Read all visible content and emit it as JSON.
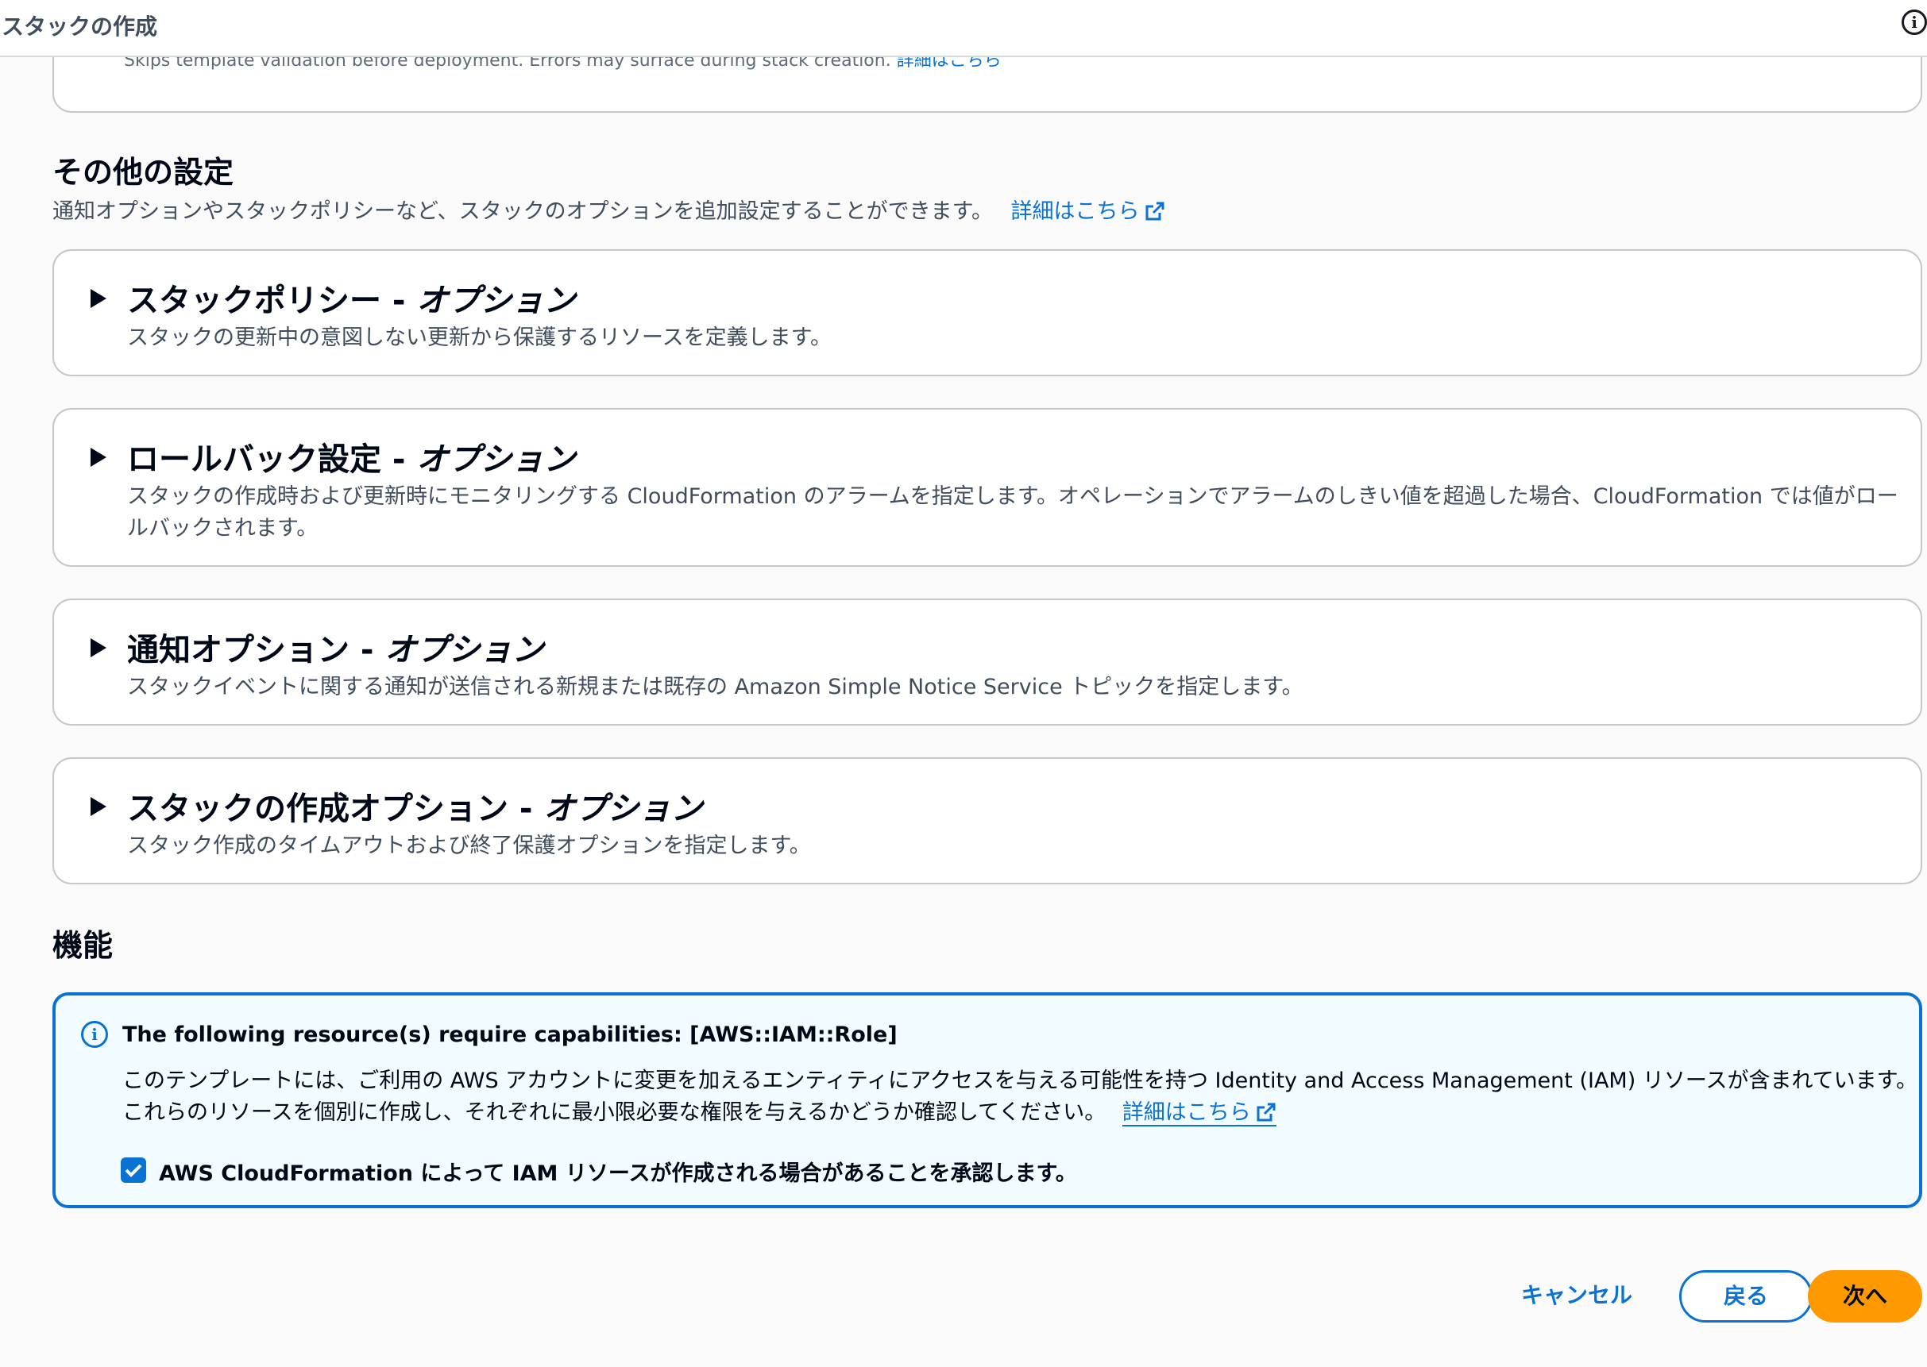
{
  "header": {
    "title": "スタックの作成",
    "info_icon": "info-icon"
  },
  "partial_card": {
    "text": "Skips template validation before deployment. Errors may surface during stack creation.",
    "link": "詳細はこちら"
  },
  "other_settings": {
    "title": "その他の設定",
    "description": "通知オプションやスタックポリシーなど、スタックのオプションを追加設定することができます。",
    "link": "詳細はこちら"
  },
  "expandables": [
    {
      "title": "スタックポリシー - ",
      "optional": "オプション",
      "description": "スタックの更新中の意図しない更新から保護するリソースを定義します。"
    },
    {
      "title": "ロールバック設定 - ",
      "optional": "オプション",
      "description": "スタックの作成時および更新時にモニタリングする CloudFormation のアラームを指定します。オペレーションでアラームのしきい値を超過した場合、CloudFormation では値がロールバックされます。"
    },
    {
      "title": "通知オプション - ",
      "optional": "オプション",
      "description": "スタックイベントに関する通知が送信される新規または既存の Amazon Simple Notice Service トピックを指定します。"
    },
    {
      "title": "スタックの作成オプション - ",
      "optional": "オプション",
      "description": "スタック作成のタイムアウトおよび終了保護オプションを指定します。"
    }
  ],
  "capabilities": {
    "title": "機能",
    "alert_title": "The following resource(s) require capabilities: [AWS::IAM::Role]",
    "alert_body": "このテンプレートには、ご利用の AWS アカウントに変更を加えるエンティティにアクセスを与える可能性を持つ Identity and Access Management (IAM) リソースが含まれています。これらのリソースを個別に作成し、それぞれに最小限必要な権限を与えるかどうか確認してください。",
    "alert_link": "詳細はこちら",
    "ack_label": "AWS CloudFormation によって IAM リソースが作成される場合があることを承認します。",
    "ack_checked": true
  },
  "footer": {
    "cancel": "キャンセル",
    "back": "戻る",
    "next": "次へ"
  },
  "colors": {
    "link": "#0972d3",
    "primary_button": "#ff9900",
    "alert_bg": "#f2fbff"
  }
}
